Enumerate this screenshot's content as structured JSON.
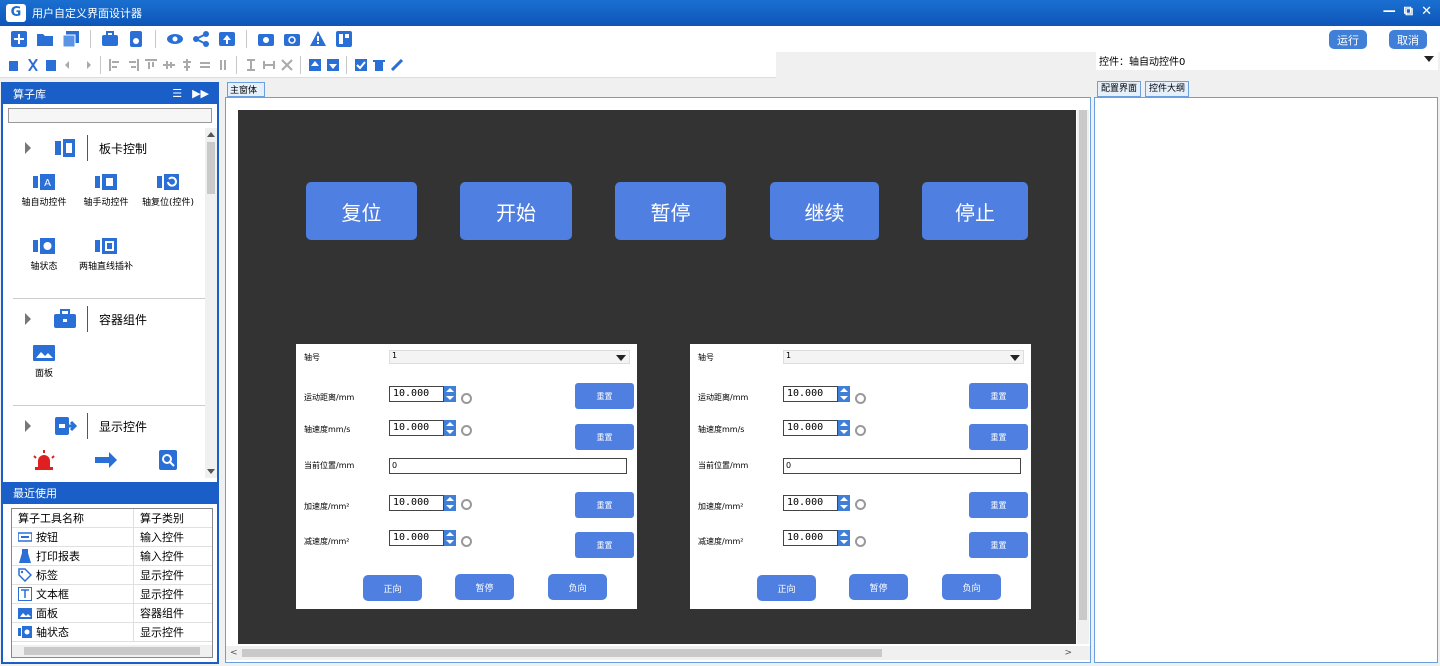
{
  "window": {
    "title": "用户自定义界面设计器",
    "app_icon": "G",
    "min": "—",
    "restore": "⧉",
    "close": "✕"
  },
  "toolbar": {
    "run_label": "运行",
    "cancel_label": "取消"
  },
  "property_bar": {
    "label": "控件：轴自动控件0"
  },
  "left_panel": {
    "title": "算子库",
    "categories": [
      {
        "label": "板卡控制",
        "items": [
          "轴自动控件",
          "轴手动控件",
          "轴复位(控件)",
          "轴状态",
          "两轴直线插补"
        ]
      },
      {
        "label": "容器组件",
        "items": [
          "面板"
        ]
      },
      {
        "label": "显示控件",
        "items": []
      }
    ],
    "recent": {
      "title": "最近使用",
      "headers": [
        "算子工具名称",
        "算子类别"
      ],
      "rows": [
        {
          "name": "按钮",
          "type": "输入控件",
          "icon": "button-icon"
        },
        {
          "name": "打印报表",
          "type": "输入控件",
          "icon": "print-report-icon"
        },
        {
          "name": "标签",
          "type": "显示控件",
          "icon": "tag-icon"
        },
        {
          "name": "文本框",
          "type": "显示控件",
          "icon": "textbox-icon"
        },
        {
          "name": "面板",
          "type": "容器组件",
          "icon": "panel-icon"
        },
        {
          "name": "轴状态",
          "type": "显示控件",
          "icon": "axis-status-icon"
        }
      ]
    }
  },
  "center": {
    "tab_label": "主窗体",
    "top_buttons": [
      "复位",
      "开始",
      "暂停",
      "继续",
      "停止"
    ],
    "axis_panels": [
      {
        "axis_label": "轴号",
        "axis_value": "1",
        "distance_label": "运动距离/mm",
        "distance_value": "10.000",
        "speed_label": "轴速度mm/s",
        "speed_value": "10.000",
        "position_label": "当前位置/mm",
        "position_value": "0",
        "accel_label": "加速度/mm²",
        "accel_value": "10.000",
        "decel_label": "减速度/mm²",
        "decel_value": "10.000",
        "reset_label": "重置",
        "forward_label": "正向",
        "pause_label": "暂停",
        "reverse_label": "负向"
      },
      {
        "axis_label": "轴号",
        "axis_value": "1",
        "distance_label": "运动距离/mm",
        "distance_value": "10.000",
        "speed_label": "轴速度mm/s",
        "speed_value": "10.000",
        "position_label": "当前位置/mm",
        "position_value": "0",
        "accel_label": "加速度/mm²",
        "accel_value": "10.000",
        "decel_label": "减速度/mm²",
        "decel_value": "10.000",
        "reset_label": "重置",
        "forward_label": "正向",
        "pause_label": "暂停",
        "reverse_label": "负向"
      }
    ]
  },
  "right_panel": {
    "tabs": [
      "配置界面",
      "控件大纲"
    ]
  },
  "colors": {
    "primary": "#1a5fc8",
    "button": "#4f7fe0",
    "canvas": "#333333",
    "title_bar": "#1a6fd0"
  }
}
